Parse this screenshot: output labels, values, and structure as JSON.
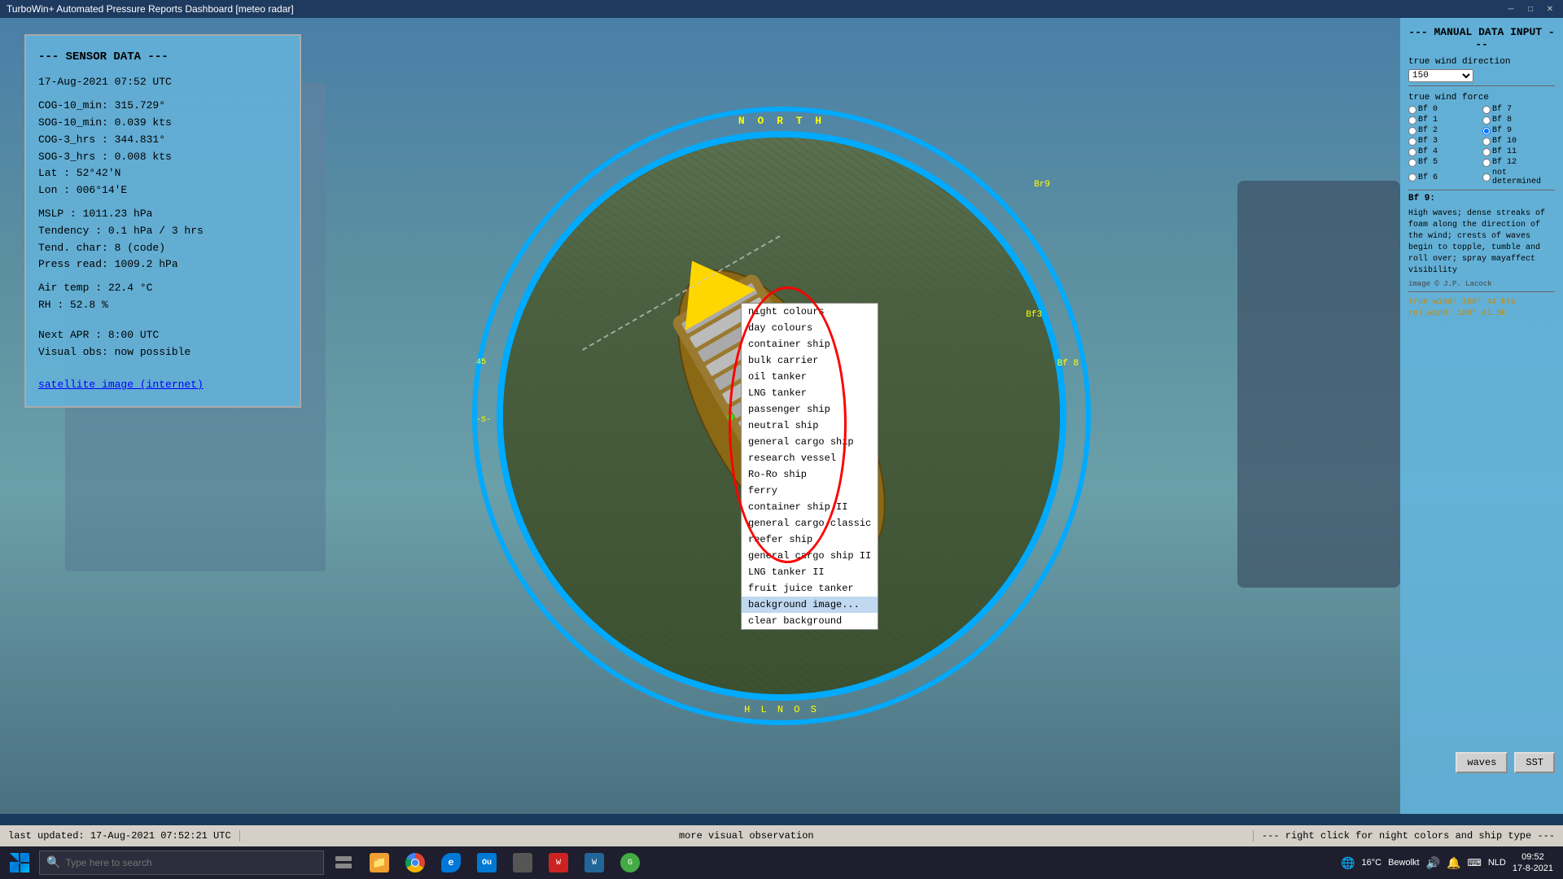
{
  "window": {
    "title": "TurboWin+ Automated Pressure Reports Dashboard [meteo radar]",
    "controls": [
      "minimize",
      "maximize",
      "close"
    ]
  },
  "sensor_panel": {
    "title": "--- SENSOR DATA ---",
    "datetime": "17-Aug-2021  07:52 UTC",
    "rows": [
      {
        "label": "COG-10_min:",
        "value": "315.729°"
      },
      {
        "label": "SOG-10_min:",
        "value": "0.039 kts"
      },
      {
        "label": "COG-3_hrs :",
        "value": "344.831°"
      },
      {
        "label": "SOG-3_hrs :",
        "value": "0.008 kts"
      },
      {
        "label": "Lat       :",
        "value": "52°42'N"
      },
      {
        "label": "Lon       :",
        "value": "006°14'E"
      }
    ],
    "weather": [
      {
        "label": "MSLP      :",
        "value": "1011.23 hPa"
      },
      {
        "label": "Tendency  :",
        "value": "0.1 hPa / 3 hrs"
      },
      {
        "label": "Tend. char:",
        "value": "8 (code)"
      },
      {
        "label": "Press read:",
        "value": "1009.2 hPa"
      }
    ],
    "environment": [
      {
        "label": "Air temp  :",
        "value": "22.4 °C"
      },
      {
        "label": "RH        :",
        "value": "52.8 %"
      }
    ],
    "schedule": [
      {
        "label": "Next APR  :",
        "value": "8:00 UTC"
      },
      {
        "label": "Visual obs:",
        "value": "now possible"
      }
    ],
    "link": "satellite image (internet)"
  },
  "radar": {
    "compass": {
      "north": "N O R T H",
      "south": "H L N O S",
      "bearing_labels": [
        "Br9",
        "Bf 8",
        "Bf3"
      ]
    }
  },
  "context_menu": {
    "items": [
      {
        "label": "night colours",
        "selected": false
      },
      {
        "label": "day colours",
        "selected": false
      },
      {
        "label": "container ship",
        "selected": false
      },
      {
        "label": "bulk carrier",
        "selected": false
      },
      {
        "label": "oil tanker",
        "selected": false
      },
      {
        "label": "LNG tanker",
        "selected": false
      },
      {
        "label": "passenger ship",
        "selected": false
      },
      {
        "label": "neutral ship",
        "selected": false
      },
      {
        "label": "general cargo ship",
        "selected": false
      },
      {
        "label": "research vessel",
        "selected": false
      },
      {
        "label": "Ro-Ro ship",
        "selected": false
      },
      {
        "label": "ferry",
        "selected": false
      },
      {
        "label": "container ship II",
        "selected": false
      },
      {
        "label": "general cargo classic",
        "selected": false
      },
      {
        "label": "reefer ship",
        "selected": false
      },
      {
        "label": "general cargo ship II",
        "selected": false
      },
      {
        "label": "LNG tanker II",
        "selected": false
      },
      {
        "label": "fruit juice tanker",
        "selected": false
      },
      {
        "label": "background image...",
        "selected": true
      },
      {
        "label": "clear background",
        "selected": false
      }
    ]
  },
  "right_panel": {
    "title": "--- MANUAL DATA INPUT ---",
    "wind_direction_label": "true wind direction",
    "wind_direction_value": "150",
    "wind_force_label": "true wind force",
    "beaufort_options": [
      {
        "label": "Bf 0",
        "col": 1
      },
      {
        "label": "Bf 7",
        "col": 2
      },
      {
        "label": "Bf 1",
        "col": 1
      },
      {
        "label": "Bf 8",
        "col": 2
      },
      {
        "label": "Bf 2",
        "col": 1
      },
      {
        "label": "Bf 9",
        "col": 2,
        "selected": true
      },
      {
        "label": "Bf 3",
        "col": 1
      },
      {
        "label": "Bf 10",
        "col": 2
      },
      {
        "label": "Bf 4",
        "col": 1
      },
      {
        "label": "Bf 11",
        "col": 2
      },
      {
        "label": "Bf 5",
        "col": 1
      },
      {
        "label": "Bf 12",
        "col": 2
      },
      {
        "label": "Bf 6",
        "col": 1
      },
      {
        "label": "not determined",
        "col": 2
      }
    ],
    "bf9_label": "Bf 9:",
    "bf9_description": "High waves; dense streaks of foam along the direction of the wind; crests of waves begin to topple, tumble and roll over; spray mayaffect visibility",
    "image_credit": "image © J.P. Lacock",
    "true_wind": "true wind: 150° 44 kts",
    "rel_wind": "rel.wind: 180° 41.5k",
    "buttons": {
      "waves": "waves",
      "sst": "SST"
    }
  },
  "statusbar": {
    "left": "last updated:  17-Aug-2021 07:52:21 UTC",
    "center": "more visual observation",
    "right": "--- right click for night colors and ship type ---"
  },
  "taskbar": {
    "search_placeholder": "Type here to search",
    "system_info": {
      "temperature": "16°C",
      "weather": "Bewolkt",
      "language": "NLD",
      "time": "09:52",
      "date": "17-8-2021"
    },
    "apps": [
      {
        "name": "file-explorer-icon",
        "color": "#f0a030"
      },
      {
        "name": "chrome-icon",
        "color": "#4285f4"
      },
      {
        "name": "edge-icon",
        "color": "#0078d7"
      },
      {
        "name": "outlook-icon",
        "color": "#0078d4"
      },
      {
        "name": "app5-icon",
        "color": "#888"
      },
      {
        "name": "app6-icon",
        "color": "#cc4444"
      },
      {
        "name": "app7-icon",
        "color": "#226699"
      },
      {
        "name": "app8-icon",
        "color": "#44aa44"
      }
    ]
  }
}
